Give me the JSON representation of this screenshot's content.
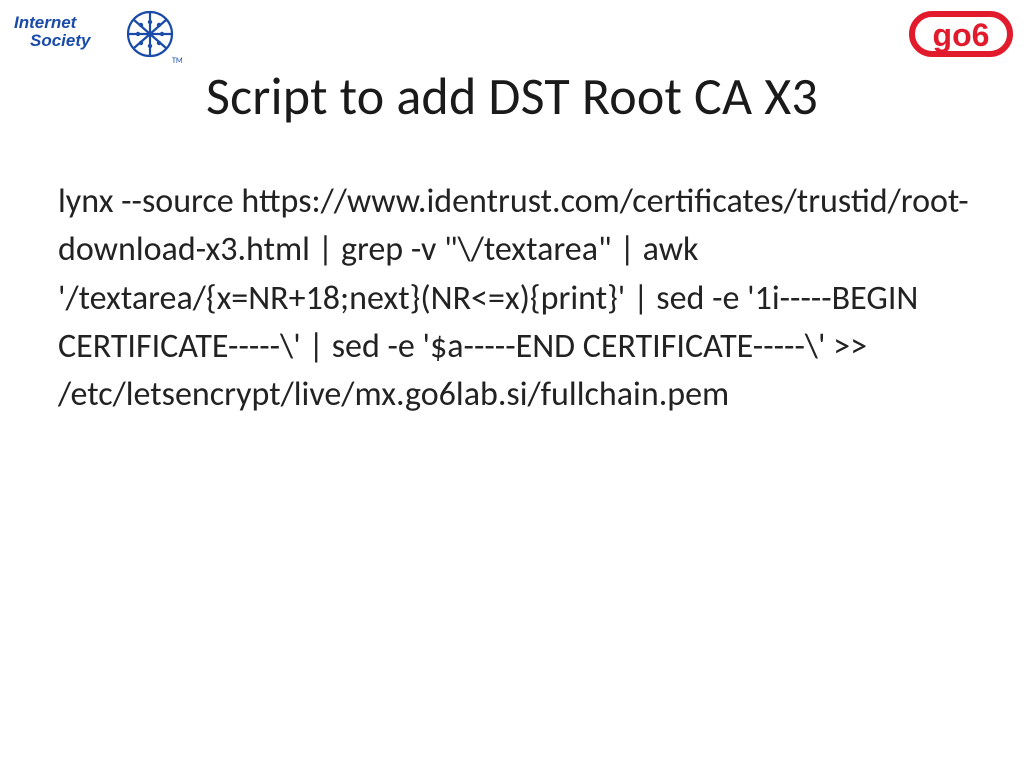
{
  "logos": {
    "left_alt": "Internet Society",
    "right_alt": "go6"
  },
  "title": "Script to add DST Root CA X3",
  "body": "lynx --source https://www.identrust.com/certificates/trustid/root-download-x3.html | grep -v \"\\/textarea\" | awk '/textarea/{x=NR+18;next}(NR<=x){print}' | sed -e '1i-----BEGIN CERTIFICATE-----\\' | sed -e '$a-----END CERTIFICATE-----\\' >> /etc/letsencrypt/live/mx.go6lab.si/fullchain.pem"
}
